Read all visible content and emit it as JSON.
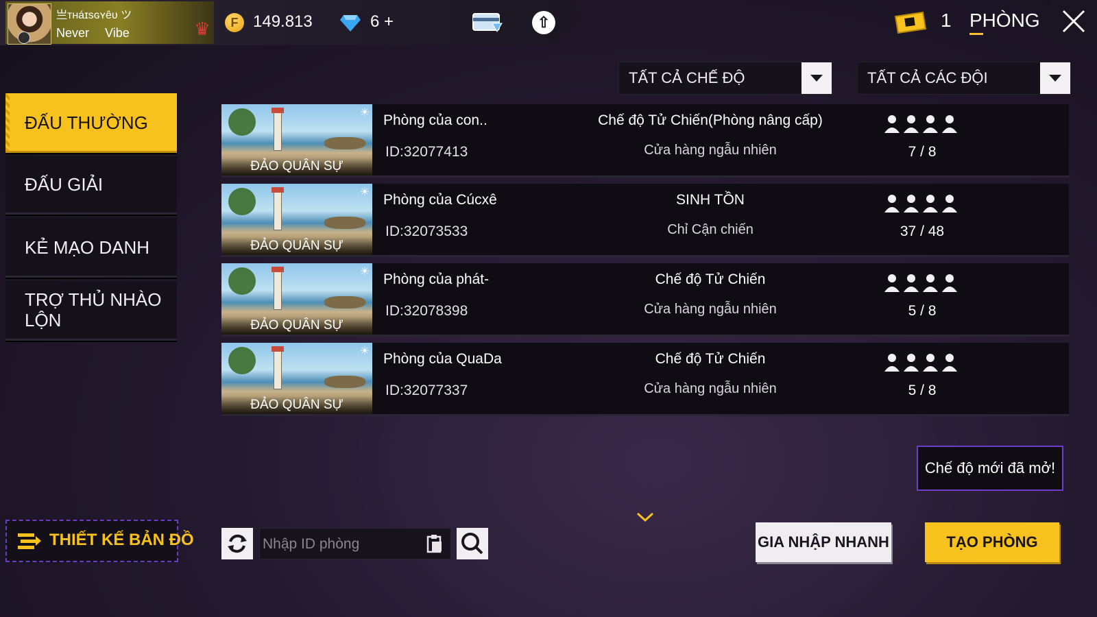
{
  "profile": {
    "nickname": "亗ᴛʜáɪsɢʏêᴜ ツ",
    "motto": "Never Vibe"
  },
  "currency": {
    "gold_symbol": "F",
    "gold": "149.813",
    "diamonds": "6",
    "diamonds_plus": "+"
  },
  "header": {
    "room_tickets": "1",
    "tab_label": "PHÒNG"
  },
  "filters": {
    "mode": "TẤT CẢ CHẾ ĐỘ",
    "team": "TẤT CẢ CÁC ĐỘI"
  },
  "sidebar": {
    "items": [
      {
        "label": "ĐẤU THƯỜNG",
        "active": true
      },
      {
        "label": "ĐẤU GIẢI",
        "active": false
      },
      {
        "label": "KẺ MẠO DANH",
        "active": false
      },
      {
        "label": "TRỢ THỦ NHÀO LỘN",
        "active": false
      }
    ]
  },
  "rooms": [
    {
      "map": "ĐẢO QUÂN SỰ",
      "name": "Phòng của con..",
      "id": "ID:32077413",
      "mode": "Chế độ Tử Chiến(Phòng nâng cấp)",
      "sub": "Cửa hàng ngẫu nhiên",
      "count": "7 / 8"
    },
    {
      "map": "ĐẢO QUÂN SỰ",
      "name": "Phòng của Cúcxê",
      "id": "ID:32073533",
      "mode": "SINH TỒN",
      "sub": "Chỉ Cận chiến",
      "count": "37 / 48"
    },
    {
      "map": "ĐẢO QUÂN SỰ",
      "name": "Phòng của phát-",
      "id": "ID:32078398",
      "mode": "Chế độ Tử Chiến",
      "sub": "Cửa hàng ngẫu nhiên",
      "count": "5 / 8"
    },
    {
      "map": "ĐẢO QUÂN SỰ",
      "name": "Phòng của QuaDa",
      "id": "ID:32077337",
      "mode": "Chế độ Tử Chiến",
      "sub": "Cửa hàng ngẫu nhiên",
      "count": "5 / 8"
    }
  ],
  "notice": "Chế độ mới đã mở!",
  "bottom": {
    "map_design": "THIẾT KẾ BẢN ĐỒ",
    "search_placeholder": "Nhập ID phòng",
    "quick_join": "GIA NHẬP NHANH",
    "create_room": "TẠO PHÒNG"
  },
  "colors": {
    "accent": "#f7c21e",
    "panel": "#0f0c13",
    "highlight_border": "#6d3ec7"
  }
}
